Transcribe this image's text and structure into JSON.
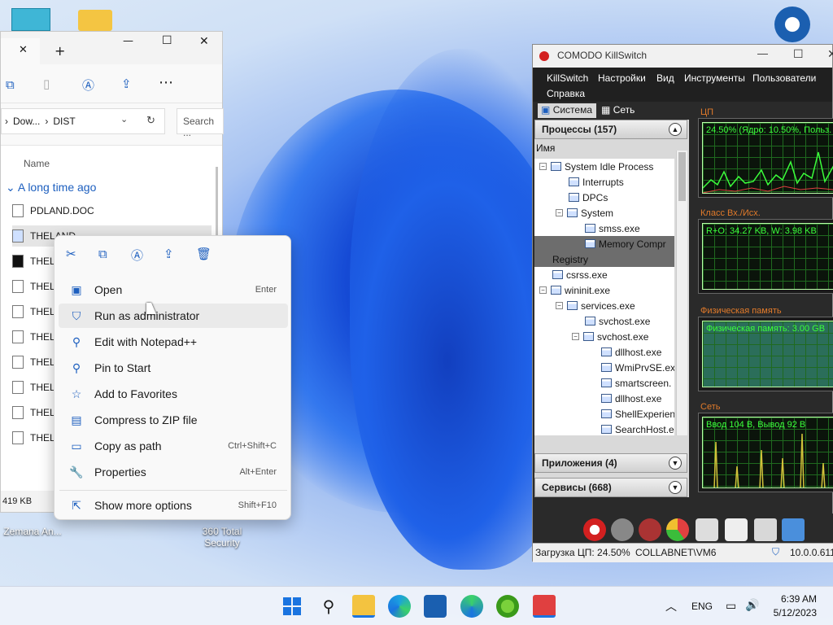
{
  "desktop": {
    "icon_zemana": "Zemana An...",
    "icon_360_line1": "360 Total",
    "icon_360_line2": "Security"
  },
  "explorer": {
    "tab_close": "✕",
    "tab_add": "+",
    "win_min": "—",
    "win_max": "☐",
    "win_close": "✕",
    "breadcrumb_1": "Dow...",
    "breadcrumb_sep": "›",
    "breadcrumb_2": "DIST",
    "search_placeholder": "Search ...",
    "col_name": "Name",
    "group": "A long time ago",
    "files": [
      "PDLAND.DOC",
      "THELAND",
      "THELA",
      "THELA",
      "THELA",
      "THELA",
      "THELA",
      "THELA",
      "THELA",
      "THELA"
    ],
    "status": "419 KB"
  },
  "context_menu": {
    "items": [
      {
        "label": "Open",
        "shortcut": "Enter"
      },
      {
        "label": "Run as administrator",
        "shortcut": ""
      },
      {
        "label": "Edit with Notepad++",
        "shortcut": ""
      },
      {
        "label": "Pin to Start",
        "shortcut": ""
      },
      {
        "label": "Add to Favorites",
        "shortcut": ""
      },
      {
        "label": "Compress to ZIP file",
        "shortcut": ""
      },
      {
        "label": "Copy as path",
        "shortcut": "Ctrl+Shift+C"
      },
      {
        "label": "Properties",
        "shortcut": "Alt+Enter"
      },
      {
        "label": "Show more options",
        "shortcut": "Shift+F10"
      }
    ]
  },
  "comodo": {
    "title": "COMODO KillSwitch",
    "menu": [
      "KillSwitch",
      "Настройки",
      "Вид",
      "Инструменты",
      "Пользователи",
      "Справка"
    ],
    "tab_system": "Система",
    "tab_network": "Сеть",
    "processes_header": "Процессы (157)",
    "col_name": "Имя",
    "processes": [
      "System Idle Process",
      "Interrupts",
      "DPCs",
      "System",
      "smss.exe",
      "Memory Compr",
      "Registry",
      "csrss.exe",
      "wininit.exe",
      "services.exe",
      "svchost.exe",
      "svchost.exe",
      "dllhost.exe",
      "WmiPrvSE.ex",
      "smartscreen.",
      "dllhost.exe",
      "ShellExperien",
      "SearchHost.e"
    ],
    "apps_header": "Приложения (4)",
    "services_header": "Сервисы (668)",
    "graph_cpu_label": "ЦП",
    "graph_cpu_text": "24.50% (Ядро: 10.50%, Польз.",
    "graph_io_label": "Класс Вх./Исх.",
    "graph_io_text": "R+O: 34.27 KB, W: 3.98 KB",
    "graph_mem_label": "Физическая память",
    "graph_mem_text": "Физическая память: 3.00 GB",
    "graph_net_label": "Сеть",
    "graph_net_text": "Ввод 104 B, Вывод 92 B",
    "status_cpu": "Загрузка ЦП: 24.50%",
    "status_user": "COLLABNET\\VM6",
    "status_ip": "10.0.0.611"
  },
  "taskbar": {
    "lang": "ENG",
    "time": "6:39 AM",
    "date": "5/12/2023",
    "chevron": "︿"
  },
  "colors": {
    "accent": "#1d5fbf",
    "graph_green": "#3bff3b",
    "graph_label": "#e07a2a"
  }
}
